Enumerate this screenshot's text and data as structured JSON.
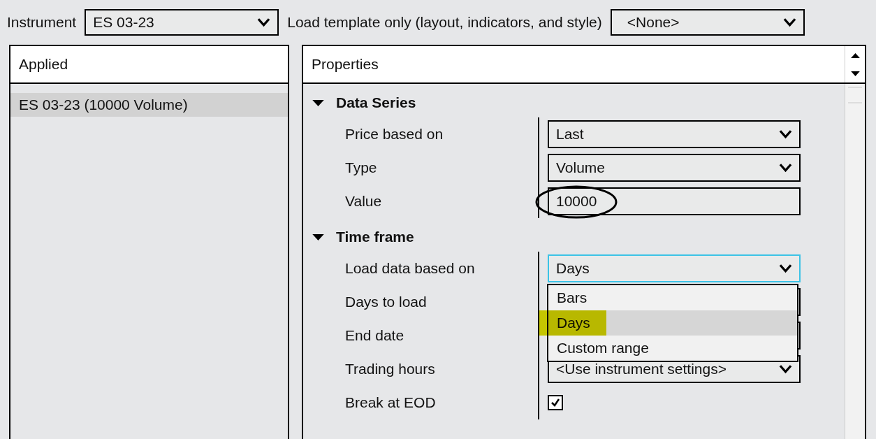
{
  "instrument": {
    "label": "Instrument",
    "value": "ES 03-23"
  },
  "template": {
    "label": "Load template only (layout, indicators, and style)",
    "value": "<None>"
  },
  "applied": {
    "title": "Applied",
    "items": [
      {
        "label": "ES 03-23 (10000 Volume)",
        "selected": true
      }
    ]
  },
  "properties": {
    "title": "Properties",
    "sections": [
      {
        "title": "Data Series",
        "expanded": true,
        "rows": [
          {
            "label": "Price based on",
            "kind": "select",
            "value": "Last"
          },
          {
            "label": "Type",
            "kind": "select",
            "value": "Volume"
          },
          {
            "label": "Value",
            "kind": "input",
            "value": "10000",
            "circled": true
          }
        ]
      },
      {
        "title": "Time frame",
        "expanded": true,
        "rows": [
          {
            "label": "Load data based on",
            "kind": "select",
            "value": "Days",
            "focused": true,
            "options": [
              {
                "label": "Bars",
                "selected": false,
                "highlighted": false
              },
              {
                "label": "Days",
                "selected": true,
                "highlighted": true
              },
              {
                "label": "Custom range",
                "selected": false,
                "highlighted": false
              }
            ]
          },
          {
            "label": "Days to load",
            "kind": "input"
          },
          {
            "label": "End date",
            "kind": "input"
          },
          {
            "label": "Trading hours",
            "kind": "select",
            "value": "<Use instrument settings>"
          },
          {
            "label": "Break at EOD",
            "kind": "checkbox",
            "checked": true
          }
        ]
      }
    ]
  }
}
